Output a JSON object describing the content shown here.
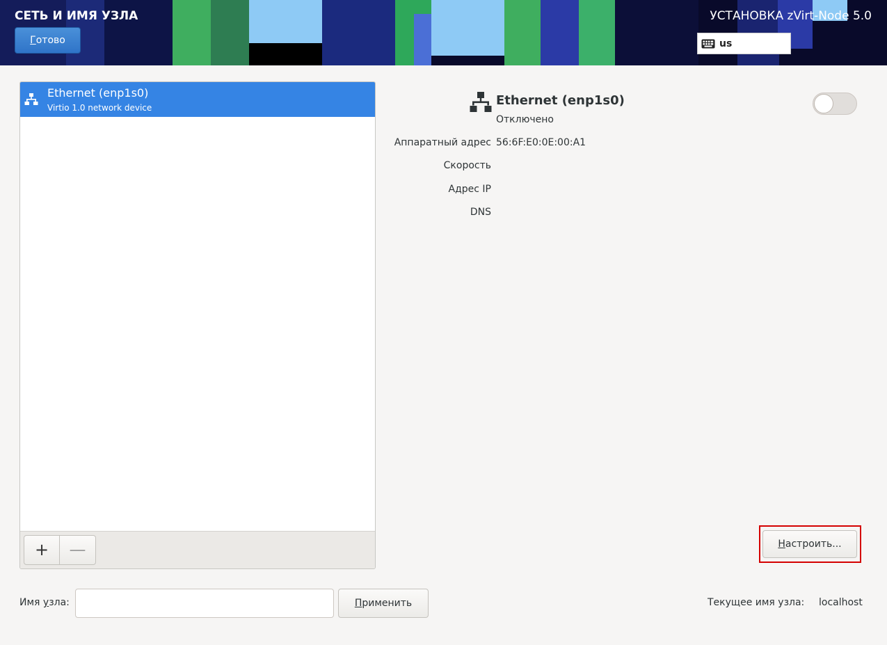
{
  "header": {
    "title": "СЕТЬ И ИМЯ УЗЛА",
    "done_button": {
      "mnemonic": "Г",
      "rest": "отово"
    },
    "installer_title": "УСТАНОВКА zVirt-Node 5.0",
    "keyboard": {
      "icon": "keyboard-icon",
      "layout": "us"
    }
  },
  "devices": [
    {
      "name": "Ethernet (enp1s0)",
      "description": "Virtio 1.0 network device",
      "icon": "network-wired-icon",
      "selected": true
    }
  ],
  "toolbar": {
    "add_label": "+",
    "remove_label": "—"
  },
  "details": {
    "icon": "network-wired-icon",
    "name": "Ethernet (enp1s0)",
    "status": "Отключено",
    "enabled": false,
    "properties": [
      {
        "label": "Аппаратный адрес",
        "value": "56:6F:E0:0E:00:A1"
      },
      {
        "label": "Скорость",
        "value": ""
      },
      {
        "label": "Адрес IP",
        "value": ""
      },
      {
        "label": "DNS",
        "value": ""
      }
    ],
    "configure_button": {
      "mnemonic": "Н",
      "rest": "астроить..."
    }
  },
  "hostname": {
    "label_before": "Имя ",
    "label_mnemonic": "у",
    "label_after": "зла:",
    "value": "",
    "apply_button": {
      "mnemonic": "П",
      "rest": "рименить"
    },
    "current_label": "Текущее имя узла:",
    "current_value": "localhost"
  },
  "colors": {
    "accent": "#3584e4",
    "highlight_border": "#d40000"
  }
}
